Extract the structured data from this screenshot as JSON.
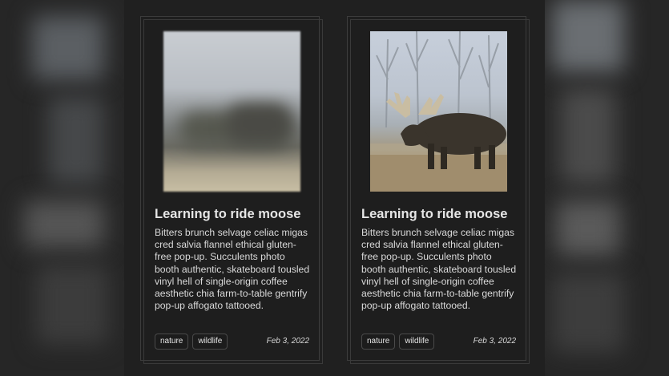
{
  "cards": [
    {
      "title": "Learning to ride moose",
      "body": "Bitters brunch selvage celiac migas cred salvia flannel ethical gluten-free pop-up. Succulents photo booth authentic, skateboard tousled vinyl hell of single-origin coffee aesthetic chia farm-to-table gentrify pop-up affogato tattooed.",
      "tags": [
        "nature",
        "wildlife"
      ],
      "date": "Feb 3, 2022",
      "image_state": "blurred"
    },
    {
      "title": "Learning to ride moose",
      "body": "Bitters brunch selvage celiac migas cred salvia flannel ethical gluten-free pop-up. Succulents photo booth authentic, skateboard tousled vinyl hell of single-origin coffee aesthetic chia farm-to-table gentrify pop-up affogato tattooed.",
      "tags": [
        "nature",
        "wildlife"
      ],
      "date": "Feb 3, 2022",
      "image_state": "loaded"
    }
  ],
  "colors": {
    "background": "#202020",
    "card_border": "#3c3c3c",
    "text": "#e6e6e6"
  }
}
